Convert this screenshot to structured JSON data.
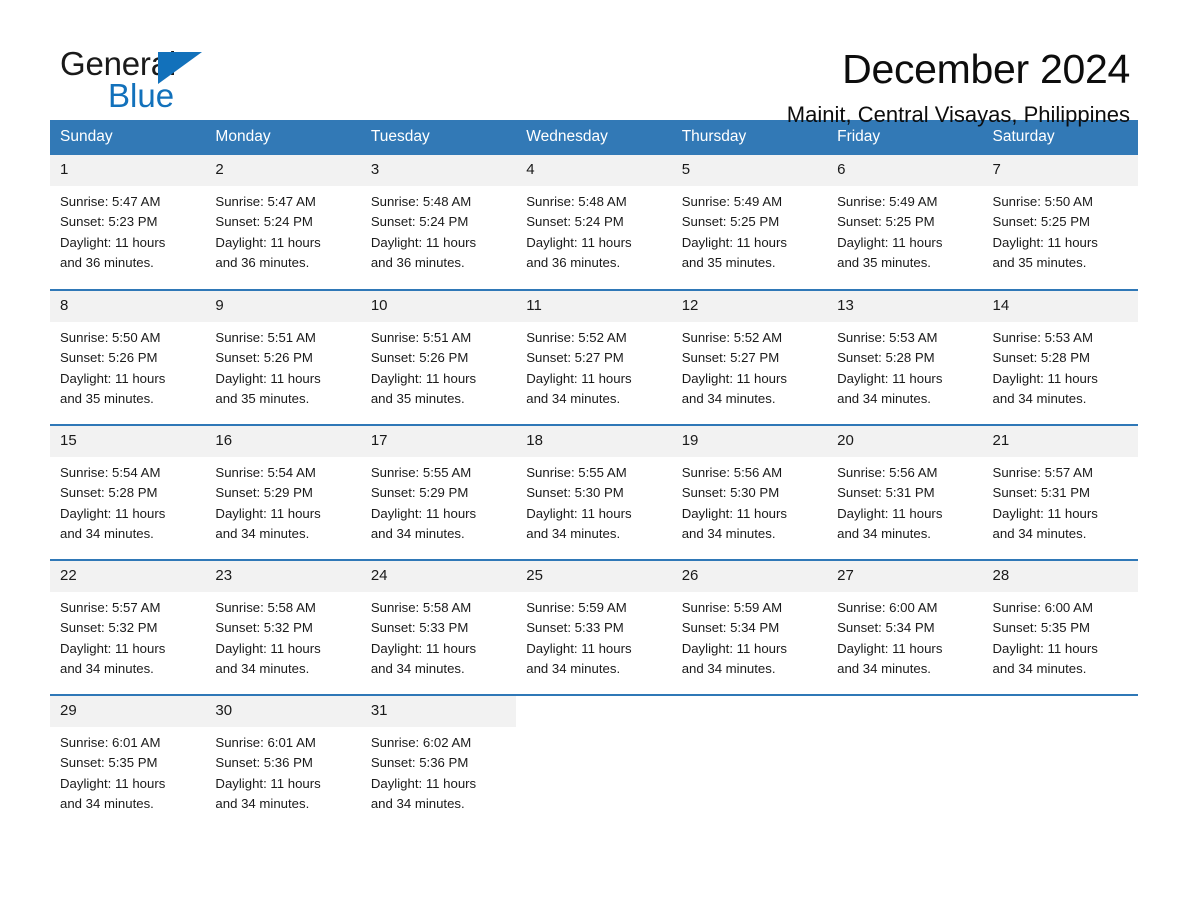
{
  "brand": {
    "name_part1": "General",
    "name_part2": "Blue",
    "accent_color": "#1271bb",
    "triangle_icon": "triangle-right-icon"
  },
  "header": {
    "title": "December 2024",
    "subtitle": "Mainit, Central Visayas, Philippines"
  },
  "theme": {
    "header_bg": "#3279b6",
    "header_text": "#ffffff",
    "daynum_bg": "#f2f2f2",
    "row_divider": "#2f78b7"
  },
  "weekday_headers": [
    "Sunday",
    "Monday",
    "Tuesday",
    "Wednesday",
    "Thursday",
    "Friday",
    "Saturday"
  ],
  "weeks": [
    [
      {
        "day": "1",
        "sunrise": "Sunrise: 5:47 AM",
        "sunset": "Sunset: 5:23 PM",
        "daylight_line1": "Daylight: 11 hours",
        "daylight_line2": "and 36 minutes."
      },
      {
        "day": "2",
        "sunrise": "Sunrise: 5:47 AM",
        "sunset": "Sunset: 5:24 PM",
        "daylight_line1": "Daylight: 11 hours",
        "daylight_line2": "and 36 minutes."
      },
      {
        "day": "3",
        "sunrise": "Sunrise: 5:48 AM",
        "sunset": "Sunset: 5:24 PM",
        "daylight_line1": "Daylight: 11 hours",
        "daylight_line2": "and 36 minutes."
      },
      {
        "day": "4",
        "sunrise": "Sunrise: 5:48 AM",
        "sunset": "Sunset: 5:24 PM",
        "daylight_line1": "Daylight: 11 hours",
        "daylight_line2": "and 36 minutes."
      },
      {
        "day": "5",
        "sunrise": "Sunrise: 5:49 AM",
        "sunset": "Sunset: 5:25 PM",
        "daylight_line1": "Daylight: 11 hours",
        "daylight_line2": "and 35 minutes."
      },
      {
        "day": "6",
        "sunrise": "Sunrise: 5:49 AM",
        "sunset": "Sunset: 5:25 PM",
        "daylight_line1": "Daylight: 11 hours",
        "daylight_line2": "and 35 minutes."
      },
      {
        "day": "7",
        "sunrise": "Sunrise: 5:50 AM",
        "sunset": "Sunset: 5:25 PM",
        "daylight_line1": "Daylight: 11 hours",
        "daylight_line2": "and 35 minutes."
      }
    ],
    [
      {
        "day": "8",
        "sunrise": "Sunrise: 5:50 AM",
        "sunset": "Sunset: 5:26 PM",
        "daylight_line1": "Daylight: 11 hours",
        "daylight_line2": "and 35 minutes."
      },
      {
        "day": "9",
        "sunrise": "Sunrise: 5:51 AM",
        "sunset": "Sunset: 5:26 PM",
        "daylight_line1": "Daylight: 11 hours",
        "daylight_line2": "and 35 minutes."
      },
      {
        "day": "10",
        "sunrise": "Sunrise: 5:51 AM",
        "sunset": "Sunset: 5:26 PM",
        "daylight_line1": "Daylight: 11 hours",
        "daylight_line2": "and 35 minutes."
      },
      {
        "day": "11",
        "sunrise": "Sunrise: 5:52 AM",
        "sunset": "Sunset: 5:27 PM",
        "daylight_line1": "Daylight: 11 hours",
        "daylight_line2": "and 34 minutes."
      },
      {
        "day": "12",
        "sunrise": "Sunrise: 5:52 AM",
        "sunset": "Sunset: 5:27 PM",
        "daylight_line1": "Daylight: 11 hours",
        "daylight_line2": "and 34 minutes."
      },
      {
        "day": "13",
        "sunrise": "Sunrise: 5:53 AM",
        "sunset": "Sunset: 5:28 PM",
        "daylight_line1": "Daylight: 11 hours",
        "daylight_line2": "and 34 minutes."
      },
      {
        "day": "14",
        "sunrise": "Sunrise: 5:53 AM",
        "sunset": "Sunset: 5:28 PM",
        "daylight_line1": "Daylight: 11 hours",
        "daylight_line2": "and 34 minutes."
      }
    ],
    [
      {
        "day": "15",
        "sunrise": "Sunrise: 5:54 AM",
        "sunset": "Sunset: 5:28 PM",
        "daylight_line1": "Daylight: 11 hours",
        "daylight_line2": "and 34 minutes."
      },
      {
        "day": "16",
        "sunrise": "Sunrise: 5:54 AM",
        "sunset": "Sunset: 5:29 PM",
        "daylight_line1": "Daylight: 11 hours",
        "daylight_line2": "and 34 minutes."
      },
      {
        "day": "17",
        "sunrise": "Sunrise: 5:55 AM",
        "sunset": "Sunset: 5:29 PM",
        "daylight_line1": "Daylight: 11 hours",
        "daylight_line2": "and 34 minutes."
      },
      {
        "day": "18",
        "sunrise": "Sunrise: 5:55 AM",
        "sunset": "Sunset: 5:30 PM",
        "daylight_line1": "Daylight: 11 hours",
        "daylight_line2": "and 34 minutes."
      },
      {
        "day": "19",
        "sunrise": "Sunrise: 5:56 AM",
        "sunset": "Sunset: 5:30 PM",
        "daylight_line1": "Daylight: 11 hours",
        "daylight_line2": "and 34 minutes."
      },
      {
        "day": "20",
        "sunrise": "Sunrise: 5:56 AM",
        "sunset": "Sunset: 5:31 PM",
        "daylight_line1": "Daylight: 11 hours",
        "daylight_line2": "and 34 minutes."
      },
      {
        "day": "21",
        "sunrise": "Sunrise: 5:57 AM",
        "sunset": "Sunset: 5:31 PM",
        "daylight_line1": "Daylight: 11 hours",
        "daylight_line2": "and 34 minutes."
      }
    ],
    [
      {
        "day": "22",
        "sunrise": "Sunrise: 5:57 AM",
        "sunset": "Sunset: 5:32 PM",
        "daylight_line1": "Daylight: 11 hours",
        "daylight_line2": "and 34 minutes."
      },
      {
        "day": "23",
        "sunrise": "Sunrise: 5:58 AM",
        "sunset": "Sunset: 5:32 PM",
        "daylight_line1": "Daylight: 11 hours",
        "daylight_line2": "and 34 minutes."
      },
      {
        "day": "24",
        "sunrise": "Sunrise: 5:58 AM",
        "sunset": "Sunset: 5:33 PM",
        "daylight_line1": "Daylight: 11 hours",
        "daylight_line2": "and 34 minutes."
      },
      {
        "day": "25",
        "sunrise": "Sunrise: 5:59 AM",
        "sunset": "Sunset: 5:33 PM",
        "daylight_line1": "Daylight: 11 hours",
        "daylight_line2": "and 34 minutes."
      },
      {
        "day": "26",
        "sunrise": "Sunrise: 5:59 AM",
        "sunset": "Sunset: 5:34 PM",
        "daylight_line1": "Daylight: 11 hours",
        "daylight_line2": "and 34 minutes."
      },
      {
        "day": "27",
        "sunrise": "Sunrise: 6:00 AM",
        "sunset": "Sunset: 5:34 PM",
        "daylight_line1": "Daylight: 11 hours",
        "daylight_line2": "and 34 minutes."
      },
      {
        "day": "28",
        "sunrise": "Sunrise: 6:00 AM",
        "sunset": "Sunset: 5:35 PM",
        "daylight_line1": "Daylight: 11 hours",
        "daylight_line2": "and 34 minutes."
      }
    ],
    [
      {
        "day": "29",
        "sunrise": "Sunrise: 6:01 AM",
        "sunset": "Sunset: 5:35 PM",
        "daylight_line1": "Daylight: 11 hours",
        "daylight_line2": "and 34 minutes."
      },
      {
        "day": "30",
        "sunrise": "Sunrise: 6:01 AM",
        "sunset": "Sunset: 5:36 PM",
        "daylight_line1": "Daylight: 11 hours",
        "daylight_line2": "and 34 minutes."
      },
      {
        "day": "31",
        "sunrise": "Sunrise: 6:02 AM",
        "sunset": "Sunset: 5:36 PM",
        "daylight_line1": "Daylight: 11 hours",
        "daylight_line2": "and 34 minutes."
      },
      {
        "day": "",
        "sunrise": "",
        "sunset": "",
        "daylight_line1": "",
        "daylight_line2": ""
      },
      {
        "day": "",
        "sunrise": "",
        "sunset": "",
        "daylight_line1": "",
        "daylight_line2": ""
      },
      {
        "day": "",
        "sunrise": "",
        "sunset": "",
        "daylight_line1": "",
        "daylight_line2": ""
      },
      {
        "day": "",
        "sunrise": "",
        "sunset": "",
        "daylight_line1": "",
        "daylight_line2": ""
      }
    ]
  ]
}
